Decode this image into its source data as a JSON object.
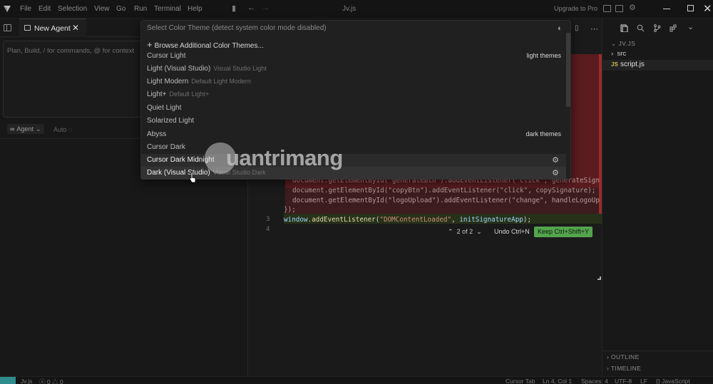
{
  "titlebar": {
    "menus": [
      "File",
      "Edit",
      "Selection",
      "View",
      "Go",
      "Run",
      "Terminal",
      "Help"
    ],
    "window_title": "Jv.js",
    "upgrade_label": "Upgrade to Pro"
  },
  "agent": {
    "tab_label": "New Agent",
    "input_placeholder": "Plan, Build, / for commands, @ for context",
    "mode_label": "Agent",
    "model_label": "Auto"
  },
  "theme_picker": {
    "placeholder": "Select Color Theme (detect system color mode disabled)",
    "browse_label": "Browse Additional Color Themes...",
    "items": [
      {
        "name": "Cursor Light",
        "sub": "",
        "group": "light themes"
      },
      {
        "name": "Light (Visual Studio)",
        "sub": "Visual Studio Light",
        "group": ""
      },
      {
        "name": "Light Modern",
        "sub": "Default Light Modern",
        "group": ""
      },
      {
        "name": "Light+",
        "sub": "Default Light+",
        "group": ""
      },
      {
        "name": "Quiet Light",
        "sub": "",
        "group": ""
      },
      {
        "name": "Solarized Light",
        "sub": "",
        "group": ""
      },
      {
        "name": "Abyss",
        "sub": "",
        "group": "dark themes"
      },
      {
        "name": "Cursor Dark",
        "sub": "",
        "group": ""
      },
      {
        "name": "Cursor Dark Midnight",
        "sub": "",
        "group": ""
      },
      {
        "name": "Dark (Visual Studio)",
        "sub": "Visual Studio Dark",
        "group": ""
      }
    ]
  },
  "editor": {
    "deleted_lines": [
      "document.getElementById(\"generateBtn\").addEventListener(\"click\", generateSign",
      "document.getElementById(\"copyBtn\").addEventListener(\"click\", copySignature);",
      "document.getElementById(\"logoUpload\").addEventListener(\"change\", handleLogoUp",
      "});"
    ],
    "line3": {
      "number": "3",
      "obj": "window",
      "method": "addEventListener",
      "arg1": "\"DOMContentLoaded\"",
      "arg2": "initSignatureApp"
    },
    "line4_number": "4",
    "diff_nav": "2 of 2",
    "undo_label": "Undo Ctrl+N",
    "keep_label": "Keep Ctrl+Shift+Y"
  },
  "explorer": {
    "root": "JV.JS",
    "folder": "src",
    "file_badge": "JS",
    "file": "script.js",
    "outline": "OUTLINE",
    "timeline": "TIMELINE"
  },
  "statusbar": {
    "file": "Jv.js",
    "errors": "0",
    "warnings": "0",
    "cursor_tab": "Cursor Tab",
    "position": "Ln 4, Col 1",
    "spaces": "Spaces: 4",
    "encoding": "UTF-8",
    "eol": "LF",
    "language": "JavaScript"
  },
  "watermark": {
    "text": "uantrimang"
  },
  "colors": {
    "keep": "#53a44d",
    "deleted": "#5a1c1f",
    "added": "#273019",
    "remote": "#2f8c8c"
  }
}
